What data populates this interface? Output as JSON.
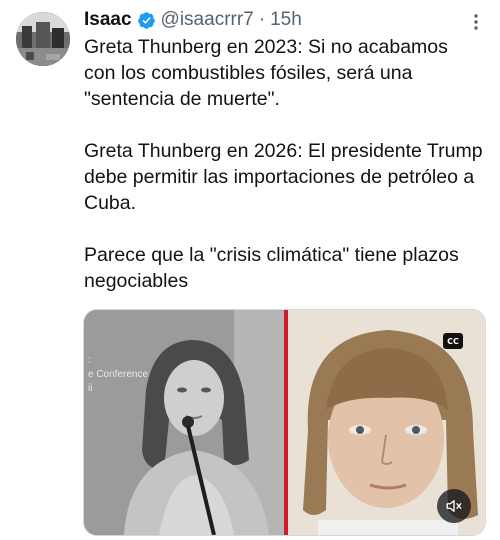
{
  "author": {
    "name": "Isaac",
    "handle": "@isaacrrr7",
    "separator": "·",
    "time": "15h",
    "verified": true
  },
  "tweet": {
    "paragraphs": [
      "Greta Thunberg en 2023: Si no acabamos con los combustibles fósiles, será una \"sentencia de muerte\".",
      "Greta Thunberg en 2026: El presidente Trump debe permitir las importaciones de petróleo a Cuba.",
      "Parece que la \"crisis climática\" tiene plazos negociables"
    ]
  },
  "media": {
    "left_overlay_text": [
      ":",
      "e Conference",
      "ii"
    ],
    "captions_badge": "CC",
    "divider_color": "#d01c2a"
  },
  "icons": {
    "verified": "verified-badge-icon",
    "more": "more-options-icon",
    "captions": "closed-captions-icon",
    "mute": "muted-speaker-icon"
  },
  "colors": {
    "text": "#0f1419",
    "secondary": "#536471",
    "verified": "#1d9bf0"
  }
}
